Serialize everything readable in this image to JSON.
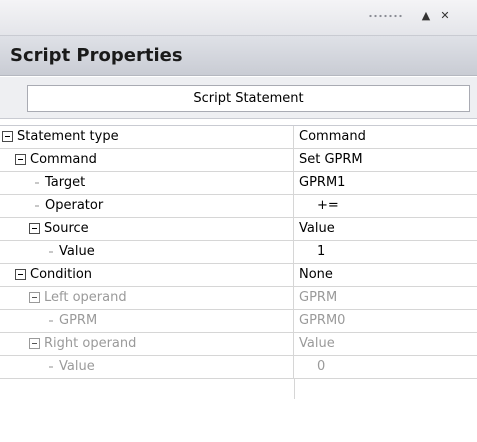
{
  "toolbar": {
    "icons": [
      "grip-dots-icon",
      "pin-arrow-icon",
      "close-icon"
    ],
    "close_label": "✕"
  },
  "panel": {
    "title": "Script Properties",
    "statement_button": "Script Statement"
  },
  "properties": [
    {
      "name": "Statement type",
      "value": "Command",
      "expander": "expanded",
      "enabled": true
    },
    {
      "name": "Command",
      "value": "Set GPRM",
      "expander": "expanded",
      "enabled": true
    },
    {
      "name": "Target",
      "value": "GPRM1",
      "expander": "leaf",
      "enabled": true
    },
    {
      "name": "Operator",
      "value": "+=",
      "expander": "leaf",
      "enabled": true
    },
    {
      "name": "Source",
      "value": "Value",
      "expander": "expanded",
      "enabled": true
    },
    {
      "name": "Value",
      "value": "1",
      "expander": "leaf",
      "enabled": true
    },
    {
      "name": "Condition",
      "value": "None",
      "expander": "expanded",
      "enabled": true
    },
    {
      "name": "Left operand",
      "value": "GPRM",
      "expander": "expanded",
      "enabled": false
    },
    {
      "name": "GPRM",
      "value": "GPRM0",
      "expander": "leaf",
      "enabled": false
    },
    {
      "name": "Right operand",
      "value": "Value",
      "expander": "expanded",
      "enabled": false
    },
    {
      "name": "Value",
      "value": "0",
      "expander": "leaf",
      "enabled": false
    }
  ],
  "colors": {
    "disabled_text": "#9a9a9a",
    "grid_line": "#d6d6d6",
    "header_bg": "#d4d6dd"
  }
}
